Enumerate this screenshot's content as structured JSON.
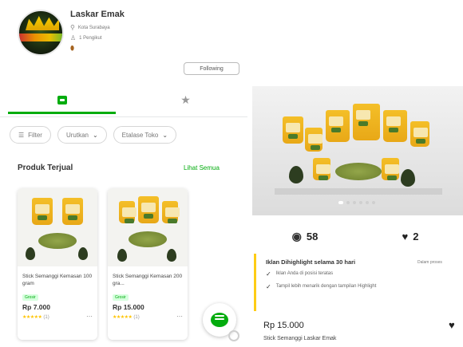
{
  "store": {
    "name": "Laskar Emak",
    "location": "Kota Surabaya",
    "followers": "1 Pengikut",
    "follow_label": "Following"
  },
  "tabs": [
    {
      "name": "store-tab",
      "icon": "store-icon",
      "active": true
    },
    {
      "name": "review-tab",
      "icon": "star-icon",
      "active": false
    }
  ],
  "filters": {
    "filter_label": "Filter",
    "sort_label": "Urutkan",
    "etalase_label": "Etalase Toko"
  },
  "section": {
    "title": "Produk Terjual",
    "see_all": "Lihat Semua"
  },
  "products": [
    {
      "name": "Stick Semanggi Kemasan 100 gram",
      "badge": "Grosir",
      "price": "Rp 7.000",
      "rating_count": "(1)"
    },
    {
      "name": "Stick Semanggi Kemasan 200 gra...",
      "badge": "Grosir",
      "price": "Rp 15.000",
      "rating_count": "(1)"
    }
  ],
  "detail": {
    "views": "58",
    "likes": "2",
    "promo_title": "Iklan Dihighlight selama 30 hari",
    "promo_side": "Dalam proses",
    "promo_lines": [
      "Iklan Anda di posisi teratas",
      "Tampil lebih menarik dengan tampilan Highlight"
    ],
    "price": "Rp 15.000",
    "product_name": "Stick Semanggi Laskar Emak"
  },
  "colors": {
    "accent": "#03ac0e",
    "highlight": "#fecc15",
    "star": "#ffc400"
  }
}
